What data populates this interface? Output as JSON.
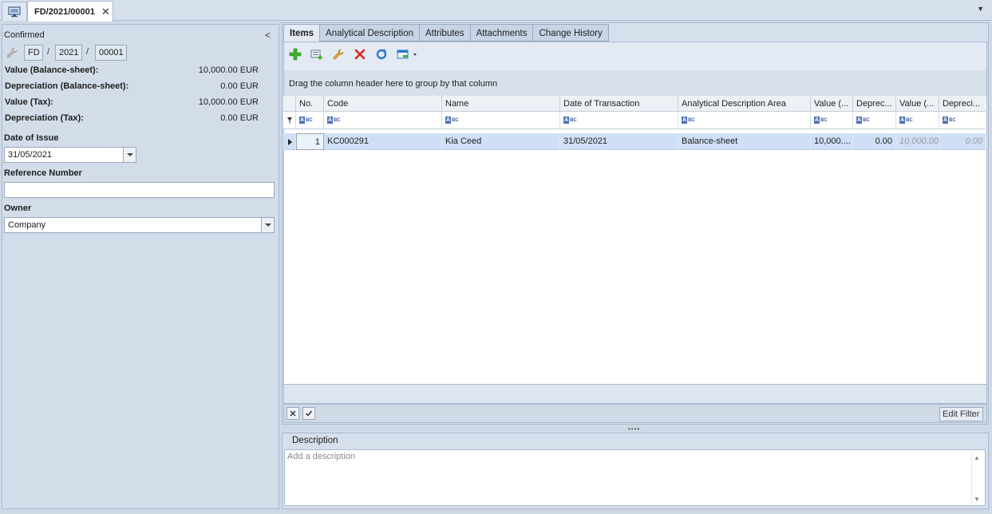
{
  "tabstrip": {
    "document_tab_label": "FD/2021/00001",
    "close_glyph": "✕",
    "dropdown_glyph": "▼"
  },
  "left": {
    "status": "Confirmed",
    "collapse_glyph": "<",
    "number": {
      "prefix": "FD",
      "year": "2021",
      "sequence": "00001",
      "separator": "/"
    },
    "values": [
      {
        "label": "Value (Balance-sheet):",
        "value": "10,000.00 EUR"
      },
      {
        "label": "Depreciation (Balance-sheet):",
        "value": "0.00 EUR"
      },
      {
        "label": "Value (Tax):",
        "value": "10,000.00 EUR"
      },
      {
        "label": "Depreciation (Tax):",
        "value": "0.00 EUR"
      }
    ],
    "date_of_issue_label": "Date of Issue",
    "date_of_issue_value": "31/05/2021",
    "reference_number_label": "Reference Number",
    "reference_number_value": "",
    "owner_label": "Owner",
    "owner_value": "Company"
  },
  "tabs": [
    "Items",
    "Analytical Description",
    "Attributes",
    "Attachments",
    "Change History"
  ],
  "toolbar": {
    "icons": [
      "add-icon",
      "add-from-list-icon",
      "edit-icon",
      "delete-icon",
      "refresh-icon",
      "export-icon"
    ]
  },
  "grid": {
    "group_hint": "Drag the column header here to group by that column",
    "columns": [
      "No.",
      "Code",
      "Name",
      "Date of Transaction",
      "Analytical Description Area",
      "Value (...",
      "Deprec...",
      "Value (...",
      "Depreci..."
    ],
    "rows": [
      {
        "no": "1",
        "code": "KC000291",
        "name": "Kia Ceed",
        "date": "31/05/2021",
        "area": "Balance-sheet",
        "value_bs": "10,000....",
        "dep_bs": "0.00",
        "value_tax": "10,000.00",
        "dep_tax": "0.00"
      }
    ],
    "edit_filter_label": "Edit Filter"
  },
  "description": {
    "title": "Description",
    "placeholder": "Add a description"
  },
  "colors": {
    "selected_row": "#cfe0f6",
    "panel": "#d6e0ec",
    "border": "#a9b9cf"
  }
}
